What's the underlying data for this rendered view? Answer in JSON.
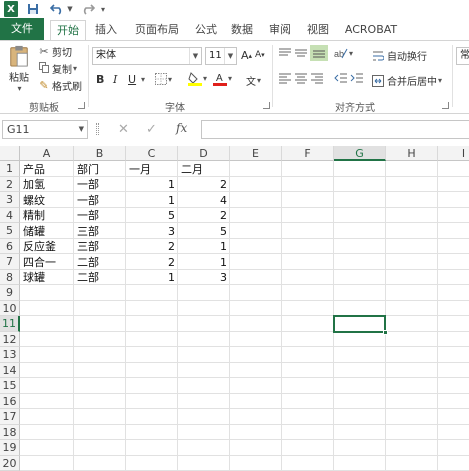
{
  "app": {
    "logo_text": "X",
    "accent": "#217346"
  },
  "tabs": [
    "文件",
    "开始",
    "插入",
    "页面布局",
    "公式",
    "数据",
    "审阅",
    "视图",
    "ACROBAT"
  ],
  "ribbon": {
    "clipboard": {
      "paste": "粘贴",
      "cut": "剪切",
      "copy": "复制",
      "format_painter": "格式刷",
      "group": "剪贴板"
    },
    "font": {
      "name": "宋体",
      "size": "11",
      "bold": "B",
      "italic": "I",
      "underline": "U",
      "grow": "A",
      "shrink": "A",
      "group": "字体",
      "phonetic": "文"
    },
    "alignment": {
      "wrap_text": "自动换行",
      "merge_center": "合并后居中",
      "group": "对齐方式"
    },
    "number": {
      "format": "常"
    }
  },
  "formula_bar": {
    "name_box": "G11",
    "fx": "fx",
    "cancel": "✕",
    "enter": "✓",
    "content": ""
  },
  "sheet": {
    "columns": [
      "A",
      "B",
      "C",
      "D",
      "E",
      "F",
      "G",
      "H",
      "I"
    ],
    "rows": [
      "1",
      "2",
      "3",
      "4",
      "5",
      "6",
      "7",
      "8",
      "9",
      "10",
      "11",
      "12",
      "13",
      "14",
      "15",
      "16",
      "17",
      "18",
      "19",
      "20"
    ],
    "selected_cell": "G11",
    "headers": [
      "产品",
      "部门",
      "一月",
      "二月"
    ],
    "data": [
      [
        "加氢",
        "一部",
        "1",
        "2"
      ],
      [
        "螺纹",
        "一部",
        "1",
        "4"
      ],
      [
        "精制",
        "一部",
        "5",
        "2"
      ],
      [
        "储罐",
        "三部",
        "3",
        "5"
      ],
      [
        "反应釜",
        "三部",
        "2",
        "1"
      ],
      [
        "四合一",
        "二部",
        "2",
        "1"
      ],
      [
        "球罐",
        "二部",
        "1",
        "3"
      ]
    ]
  }
}
